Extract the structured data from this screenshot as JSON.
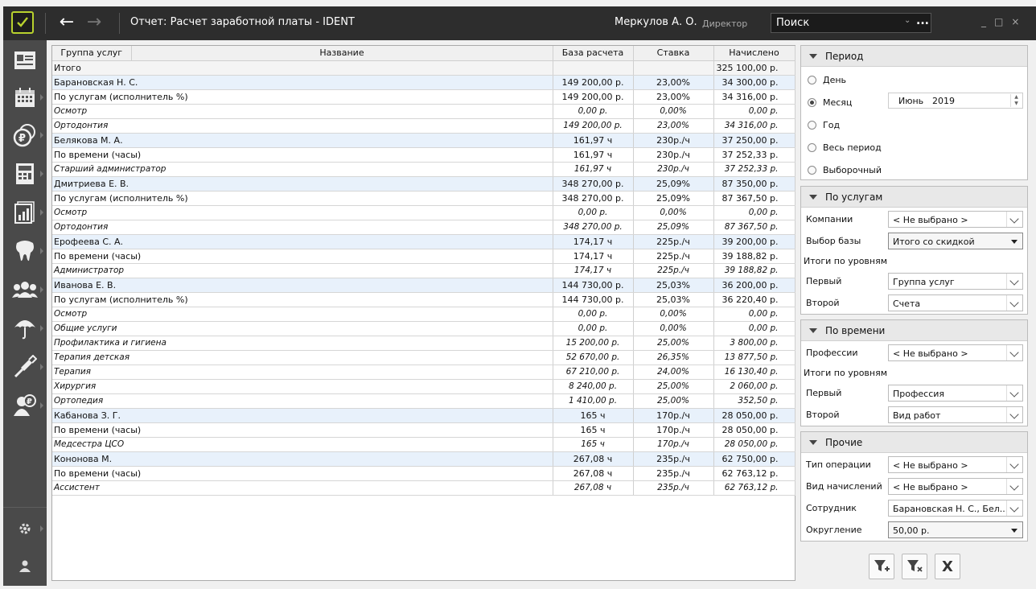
{
  "titlebar": {
    "title": "Отчет: Расчет заработной платы  -  IDENT",
    "user_name": "Меркулов А. О.",
    "user_role": "Директор",
    "search_placeholder": "Поиск",
    "search_more": "...",
    "win_min": "_",
    "win_max": "□",
    "win_close": "×"
  },
  "sidebar": {
    "items": [
      "patient-card-icon",
      "calendar-icon",
      "payments-icon",
      "cash-register-icon",
      "reports-icon",
      "tooth-icon",
      "staff-icon",
      "insurance-icon",
      "tools-icon",
      "salary-icon"
    ],
    "bottom": [
      "settings-icon",
      "user-icon"
    ]
  },
  "table": {
    "columns": [
      "Группа услуг",
      "Название",
      "База расчета",
      "Ставка",
      "Начислено"
    ],
    "rows": [
      {
        "level": "total",
        "name": "Итого",
        "base": "",
        "rate": "",
        "accrued": "325 100,00 р."
      },
      {
        "level": "lvl1",
        "name": "Барановская Н. С.",
        "base": "149 200,00 р.",
        "rate": "23,00%",
        "accrued": "34 300,00 р."
      },
      {
        "level": "lvl2",
        "name": "По услугам (исполнитель %)",
        "base": "149 200,00 р.",
        "rate": "23,00%",
        "accrued": "34 316,00 р."
      },
      {
        "level": "lvl3",
        "name": "Осмотр",
        "base": "0,00 р.",
        "rate": "0,00%",
        "accrued": "0,00 р."
      },
      {
        "level": "lvl3",
        "name": "Ортодонтия",
        "base": "149 200,00 р.",
        "rate": "23,00%",
        "accrued": "34 316,00 р."
      },
      {
        "level": "lvl1",
        "name": "Белякова М. А.",
        "base": "161,97 ч",
        "rate": "230р./ч",
        "accrued": "37 250,00 р."
      },
      {
        "level": "lvl2",
        "name": "По времени (часы)",
        "base": "161,97 ч",
        "rate": "230р./ч",
        "accrued": "37 252,33 р."
      },
      {
        "level": "lvl3",
        "name": "Старший администратор",
        "base": "161,97 ч",
        "rate": "230р./ч",
        "accrued": "37 252,33 р."
      },
      {
        "level": "lvl1",
        "name": "Дмитриева Е. В.",
        "base": "348 270,00 р.",
        "rate": "25,09%",
        "accrued": "87 350,00 р."
      },
      {
        "level": "lvl2",
        "name": "По услугам (исполнитель %)",
        "base": "348 270,00 р.",
        "rate": "25,09%",
        "accrued": "87 367,50 р."
      },
      {
        "level": "lvl3",
        "name": "Осмотр",
        "base": "0,00 р.",
        "rate": "0,00%",
        "accrued": "0,00 р."
      },
      {
        "level": "lvl3",
        "name": "Ортодонтия",
        "base": "348 270,00 р.",
        "rate": "25,09%",
        "accrued": "87 367,50 р."
      },
      {
        "level": "lvl1",
        "name": "Ерофеева С. А.",
        "base": "174,17 ч",
        "rate": "225р./ч",
        "accrued": "39 200,00 р."
      },
      {
        "level": "lvl2",
        "name": "По времени (часы)",
        "base": "174,17 ч",
        "rate": "225р./ч",
        "accrued": "39 188,82 р."
      },
      {
        "level": "lvl3",
        "name": "Администратор",
        "base": "174,17 ч",
        "rate": "225р./ч",
        "accrued": "39 188,82 р."
      },
      {
        "level": "lvl1",
        "name": "Иванова Е. В.",
        "base": "144 730,00 р.",
        "rate": "25,03%",
        "accrued": "36 200,00 р."
      },
      {
        "level": "lvl2",
        "name": "По услугам (исполнитель %)",
        "base": "144 730,00 р.",
        "rate": "25,03%",
        "accrued": "36 220,40 р."
      },
      {
        "level": "lvl3",
        "name": "Осмотр",
        "base": "0,00 р.",
        "rate": "0,00%",
        "accrued": "0,00 р."
      },
      {
        "level": "lvl3",
        "name": "Общие услуги",
        "base": "0,00 р.",
        "rate": "0,00%",
        "accrued": "0,00 р."
      },
      {
        "level": "lvl3",
        "name": "Профилактика и гигиена",
        "base": "15 200,00 р.",
        "rate": "25,00%",
        "accrued": "3 800,00 р."
      },
      {
        "level": "lvl3",
        "name": "Терапия детская",
        "base": "52 670,00 р.",
        "rate": "26,35%",
        "accrued": "13 877,50 р."
      },
      {
        "level": "lvl3",
        "name": "Терапия",
        "base": "67 210,00 р.",
        "rate": "24,00%",
        "accrued": "16 130,40 р."
      },
      {
        "level": "lvl3",
        "name": "Хирургия",
        "base": "8 240,00 р.",
        "rate": "25,00%",
        "accrued": "2 060,00 р."
      },
      {
        "level": "lvl3",
        "name": "Ортопедия",
        "base": "1 410,00 р.",
        "rate": "25,00%",
        "accrued": "352,50 р."
      },
      {
        "level": "lvl1",
        "name": "Кабанова З. Г.",
        "base": "165 ч",
        "rate": "170р./ч",
        "accrued": "28 050,00 р."
      },
      {
        "level": "lvl2",
        "name": "По времени (часы)",
        "base": "165 ч",
        "rate": "170р./ч",
        "accrued": "28 050,00 р."
      },
      {
        "level": "lvl3",
        "name": "Медсестра ЦСО",
        "base": "165 ч",
        "rate": "170р./ч",
        "accrued": "28 050,00 р."
      },
      {
        "level": "lvl1",
        "name": "Кононова М.",
        "base": "267,08 ч",
        "rate": "235р./ч",
        "accrued": "62 750,00 р."
      },
      {
        "level": "lvl2",
        "name": "По времени (часы)",
        "base": "267,08 ч",
        "rate": "235р./ч",
        "accrued": "62 763,12 р."
      },
      {
        "level": "lvl3",
        "name": "Ассистент",
        "base": "267,08 ч",
        "rate": "235р./ч",
        "accrued": "62 763,12 р."
      }
    ]
  },
  "period": {
    "title": "Период",
    "options": [
      "День",
      "Месяц",
      "Год",
      "Весь период",
      "Выборочный"
    ],
    "selected": "Месяц",
    "month": "Июнь",
    "year": "2019"
  },
  "services": {
    "title": "По услугам",
    "company_label": "Компании",
    "company_value": "< Не выбрано >",
    "base_label": "Выбор базы",
    "base_value": "Итого со скидкой",
    "levels_label": "Итоги по уровням",
    "first_label": "Первый",
    "first_value": "Группа услуг",
    "second_label": "Второй",
    "second_value": "Счета"
  },
  "time": {
    "title": "По времени",
    "prof_label": "Профессии",
    "prof_value": "< Не выбрано >",
    "levels_label": "Итоги по уровням",
    "first_label": "Первый",
    "first_value": "Профессия",
    "second_label": "Второй",
    "second_value": "Вид работ"
  },
  "other": {
    "title": "Прочие",
    "op_label": "Тип операции",
    "op_value": "< Не выбрано >",
    "acc_label": "Вид начислений",
    "acc_value": "< Не выбрано >",
    "emp_label": "Сотрудник",
    "emp_value": "Барановская Н. С., Бел...",
    "round_label": "Округление",
    "round_value": "50,00 р."
  },
  "actions": {
    "clear_label": "X"
  },
  "colors": {
    "titlebar": "#2d2d2d",
    "sidebar": "#4a4a4a",
    "logo_accent": "#b8d12e",
    "level1_row": "#e8f1fb"
  }
}
